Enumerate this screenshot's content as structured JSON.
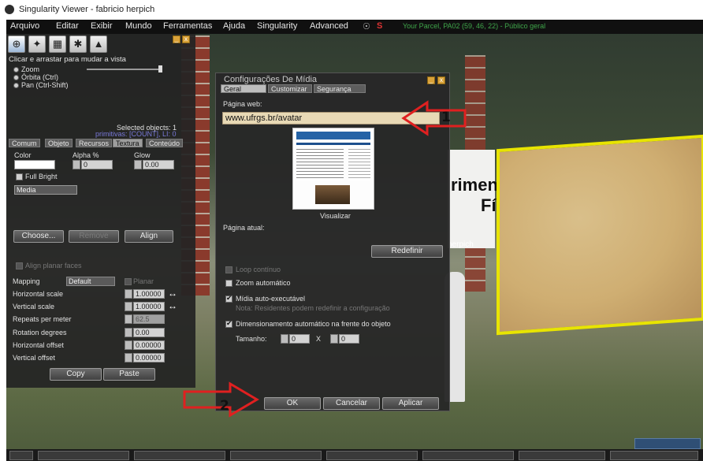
{
  "window": {
    "title": "Singularity Viewer - fabricio herpich"
  },
  "menubar": {
    "items": [
      "Arquivo",
      "Editar",
      "Exibir",
      "Mundo",
      "Ferramentas",
      "Ajuda",
      "Singularity",
      "Advanced"
    ],
    "parcel_info": "Your Parcel, PA02 (59, 46, 22) - Público geral"
  },
  "scene": {
    "sign_text_1": "rimen",
    "sign_text_2": "Fí",
    "avatar_name": "herpich"
  },
  "edit_panel": {
    "tool_icons": [
      "focus-tool-icon",
      "move-tool-icon",
      "edit-tool-icon",
      "create-tool-icon",
      "land-tool-icon"
    ],
    "hint": "Clicar e arrastar para mudar a vista",
    "camera_options": [
      "Zoom",
      "Órbita (Ctrl)",
      "Pan (Ctrl-Shift)"
    ],
    "selected_objects": "Selected objects: 1",
    "primitives": "primitivas: [COUNT], LI: 0",
    "tabs": [
      "Comum",
      "Objeto",
      "Recursos",
      "Textura",
      "Conteúdo"
    ],
    "active_tab": "Textura",
    "color_label": "Color",
    "alpha_label": "Alpha %",
    "alpha_value": "0",
    "glow_label": "Glow",
    "glow_value": "0.00",
    "full_bright_label": "Full Bright",
    "media_dropdown": "Media",
    "choose_button": "Choose...",
    "remove_button": "Remove",
    "align_button": "Align",
    "align_planar_label": "Align planar faces",
    "mapping_label": "Mapping",
    "mapping_value": "Default",
    "planar_label": "Planar",
    "horizontal_scale_label": "Horizontal scale",
    "horizontal_scale_value": "1.00000",
    "vertical_scale_label": "Vertical scale",
    "vertical_scale_value": "1.00000",
    "repeats_label": "Repeats per meter",
    "repeats_value": "62.5",
    "rotation_label": "Rotation degrees",
    "rotation_value": "0.00",
    "horizontal_offset_label": "Horizontal offset",
    "horizontal_offset_value": "0.00000",
    "vertical_offset_label": "Vertical offset",
    "vertical_offset_value": "0.00000",
    "copy_button": "Copy",
    "paste_button": "Paste"
  },
  "media_dialog": {
    "title": "Configurações De Mídia",
    "tabs": [
      "Geral",
      "Customizar",
      "Segurança"
    ],
    "active_tab": "Geral",
    "web_page_label": "Página web:",
    "url_value": "www.ufrgs.br/avatar",
    "preview_label": "Visualizar",
    "current_page_label": "Página atual:",
    "reset_button": "Redefinir",
    "loop_label": "Loop contínuo",
    "auto_zoom_label": "Zoom automático",
    "auto_play_label": "Mídia auto-executável",
    "auto_play_note": "Nota: Residentes podem redefinir a configuração",
    "auto_scale_label": "Dimensionamento automático na frente do objeto",
    "size_label": "Tamanho:",
    "width_value": "0",
    "size_x": "X",
    "height_value": "0",
    "ok_button": "OK",
    "cancel_button": "Cancelar",
    "apply_button": "Aplicar"
  },
  "annotations": {
    "marker_1": "1",
    "marker_2": "2"
  },
  "colors": {
    "arrow_red": "#e02020",
    "highlight_yellow": "#e8e400",
    "dialog_bg": "#282828",
    "url_field_bg": "#e8d9b5"
  }
}
